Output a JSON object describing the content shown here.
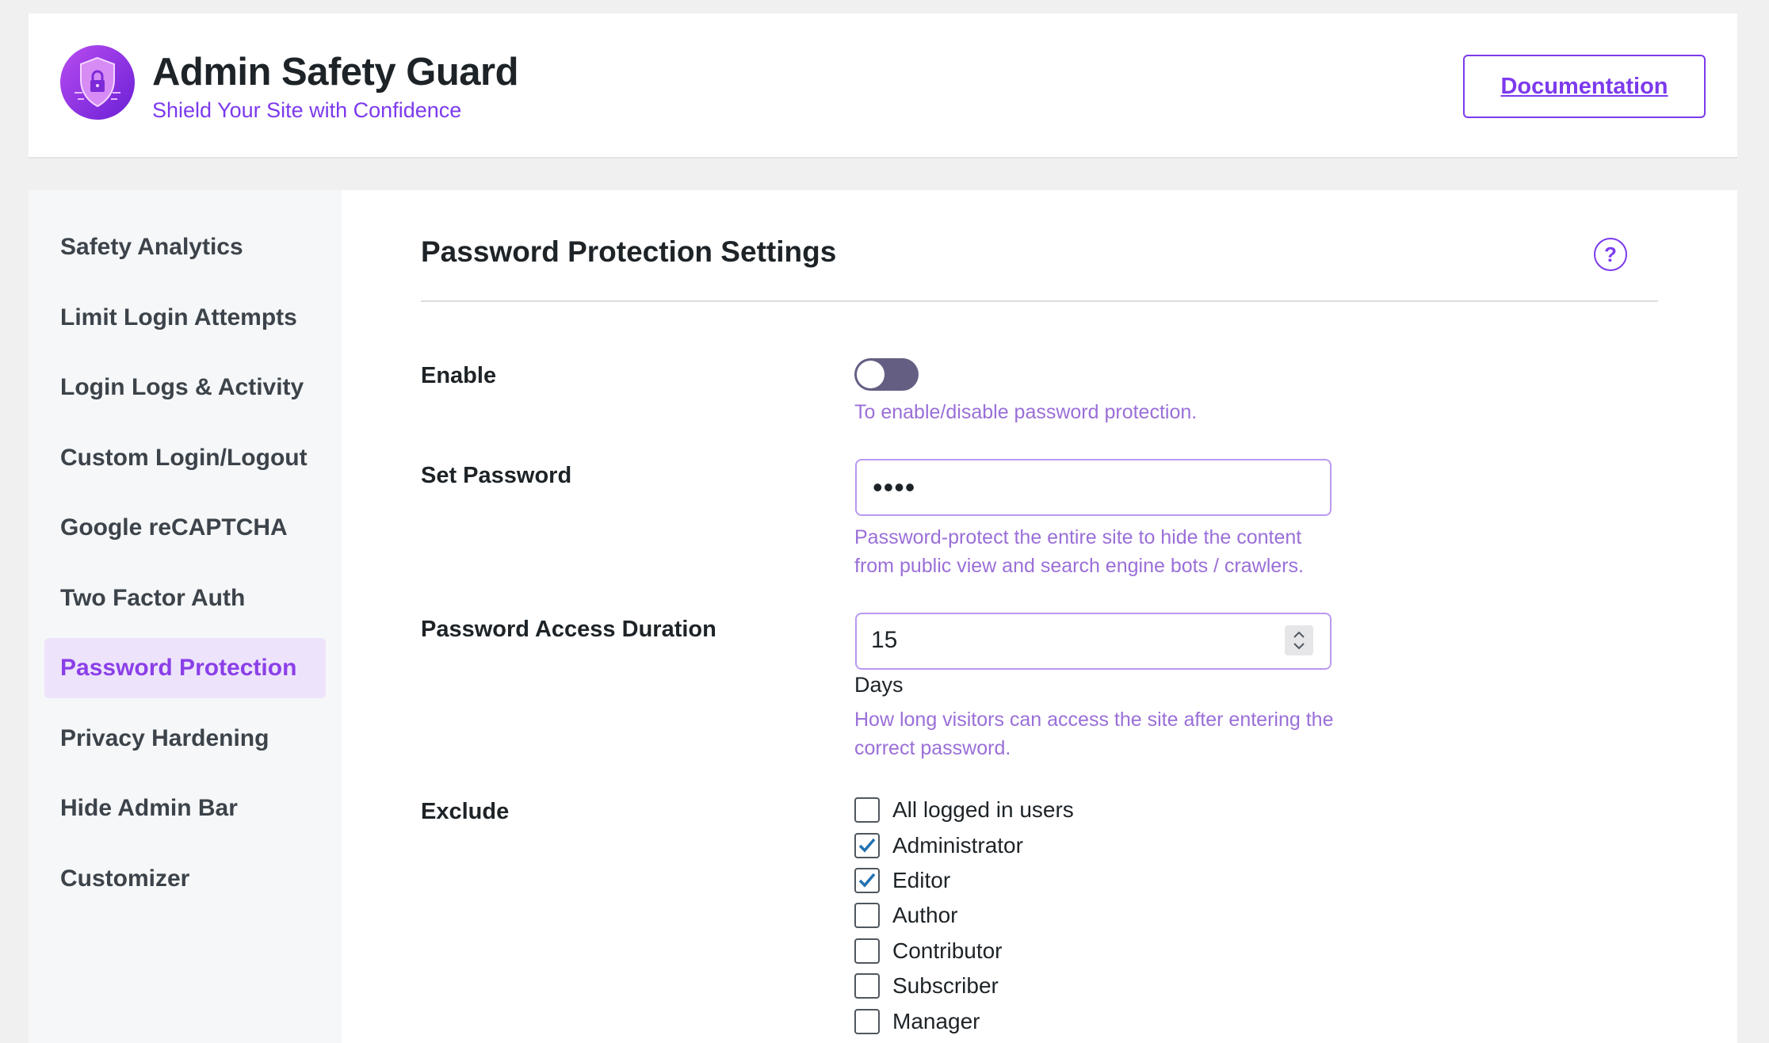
{
  "header": {
    "title": "Admin Safety Guard",
    "subtitle": "Shield Your Site with Confidence",
    "doc_button": "Documentation"
  },
  "sidebar": {
    "items": [
      {
        "label": "Safety Analytics",
        "active": false
      },
      {
        "label": "Limit Login Attempts",
        "active": false
      },
      {
        "label": "Login Logs & Activity",
        "active": false
      },
      {
        "label": "Custom Login/Logout",
        "active": false
      },
      {
        "label": "Google reCAPTCHA",
        "active": false
      },
      {
        "label": "Two Factor Auth",
        "active": false
      },
      {
        "label": "Password Protection",
        "active": true
      },
      {
        "label": "Privacy Hardening",
        "active": false
      },
      {
        "label": "Hide Admin Bar",
        "active": false
      },
      {
        "label": "Customizer",
        "active": false
      }
    ]
  },
  "settings": {
    "title": "Password Protection Settings",
    "help_icon": "?",
    "enable": {
      "label": "Enable",
      "state": "off",
      "help": "To enable/disable password protection."
    },
    "password": {
      "label": "Set Password",
      "value": "••••",
      "help": "Password-protect the entire site to hide the content from public view and search engine bots / crawlers."
    },
    "duration": {
      "label": "Password Access Duration",
      "value": "15",
      "unit": "Days",
      "help": "How long visitors can access the site after entering the correct password."
    },
    "exclude": {
      "label": "Exclude",
      "options": [
        {
          "label": "All logged in users",
          "checked": false
        },
        {
          "label": "Administrator",
          "checked": true
        },
        {
          "label": "Editor",
          "checked": true
        },
        {
          "label": "Author",
          "checked": false
        },
        {
          "label": "Contributor",
          "checked": false
        },
        {
          "label": "Subscriber",
          "checked": false
        },
        {
          "label": "Manager",
          "checked": false
        }
      ]
    }
  },
  "colors": {
    "accent": "#7c3aed",
    "help_text": "#9a6fd8",
    "toggle_track": "#645f82",
    "checkmark": "#2271b1"
  }
}
